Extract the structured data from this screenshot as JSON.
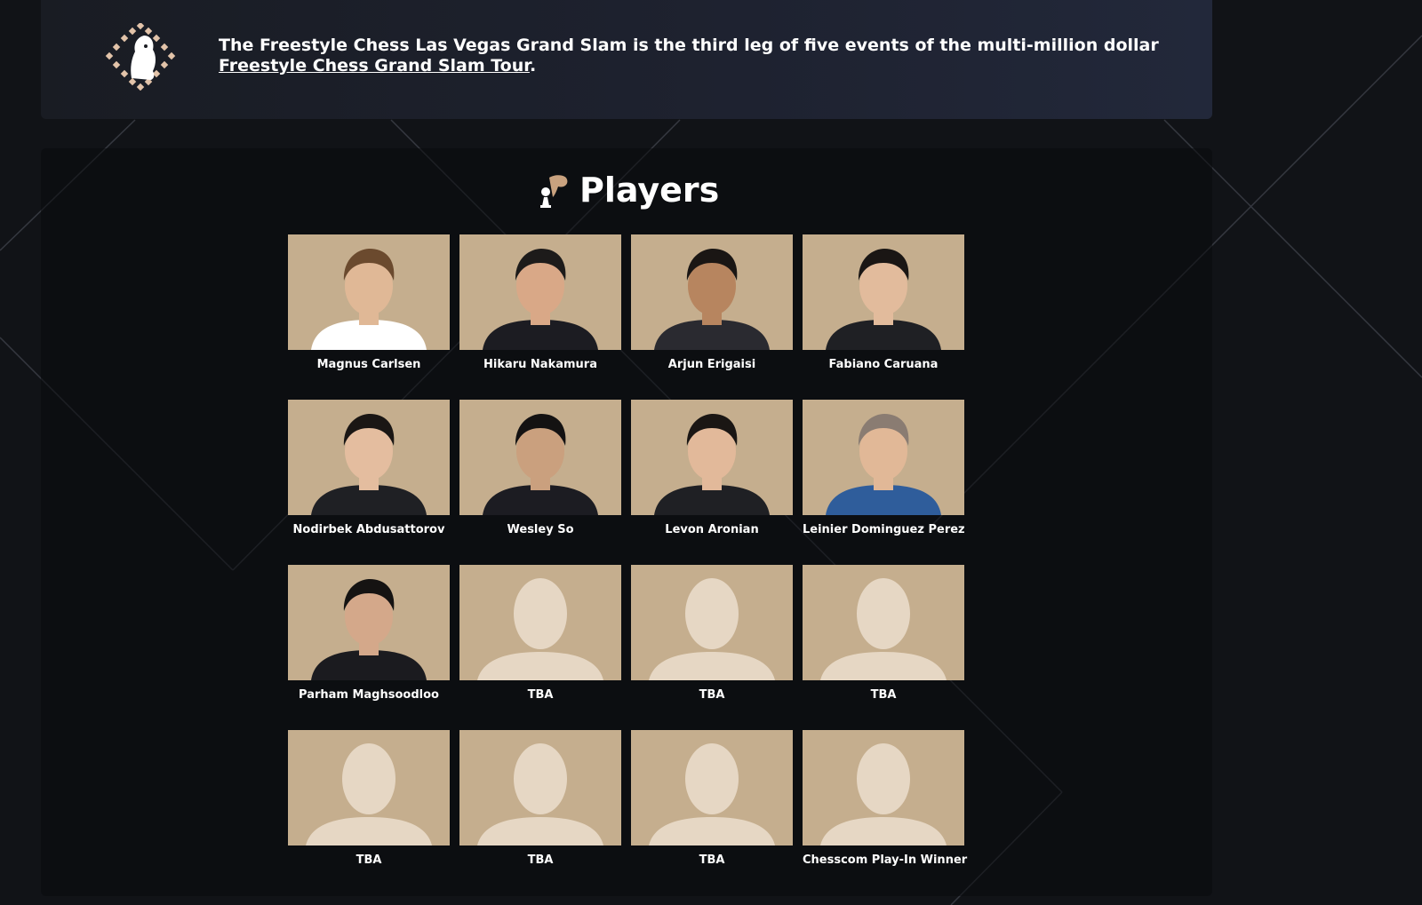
{
  "banner": {
    "text_before": "The Freestyle Chess Las Vegas Grand Slam is the third leg of five events of the multi-million dollar ",
    "link_text": "Freestyle Chess Grand Slam Tour",
    "text_after": "."
  },
  "players_section": {
    "title": "Players"
  },
  "players": [
    {
      "name": "Magnus Carlsen",
      "photo": "portrait"
    },
    {
      "name": "Hikaru Nakamura",
      "photo": "portrait"
    },
    {
      "name": "Arjun Erigaisi",
      "photo": "portrait"
    },
    {
      "name": "Fabiano Caruana",
      "photo": "portrait"
    },
    {
      "name": "Nodirbek Abdusattorov",
      "photo": "portrait"
    },
    {
      "name": "Wesley So",
      "photo": "portrait"
    },
    {
      "name": "Levon Aronian",
      "photo": "portrait"
    },
    {
      "name": "Leinier Dominguez Perez",
      "photo": "portrait"
    },
    {
      "name": "Parham Maghsoodloo",
      "photo": "portrait"
    },
    {
      "name": "TBA",
      "photo": "placeholder"
    },
    {
      "name": "TBA",
      "photo": "placeholder"
    },
    {
      "name": "TBA",
      "photo": "placeholder"
    },
    {
      "name": "TBA",
      "photo": "placeholder"
    },
    {
      "name": "TBA",
      "photo": "placeholder"
    },
    {
      "name": "TBA",
      "photo": "placeholder"
    },
    {
      "name": "Chesscom Play-In Winner",
      "photo": "placeholder"
    }
  ]
}
